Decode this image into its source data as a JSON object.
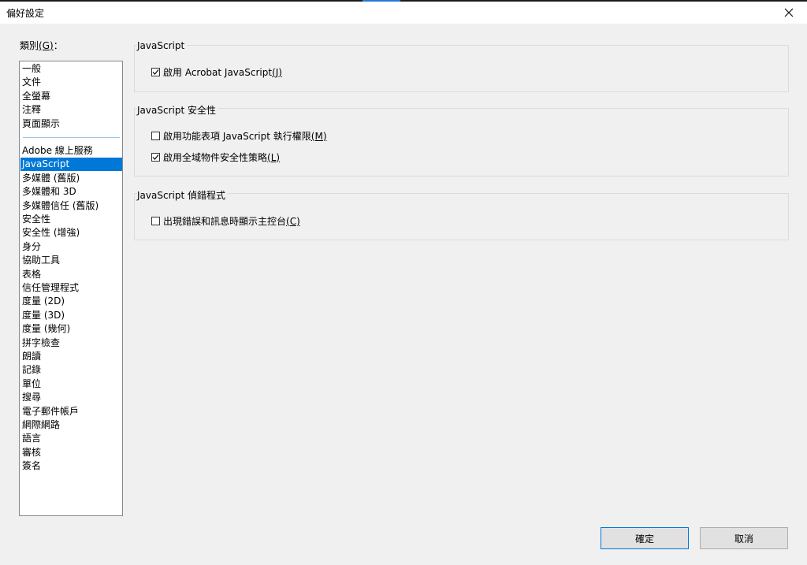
{
  "window": {
    "title": "偏好設定"
  },
  "sidebar": {
    "label": "類別",
    "accel": "(G)",
    "suffix": "：",
    "top_items": [
      "一般",
      "文件",
      "全螢幕",
      "注釋",
      "頁面顯示"
    ],
    "items": [
      "Adobe 線上服務",
      "JavaScript",
      "多媒體 (舊版)",
      "多媒體和 3D",
      "多媒體信任 (舊版)",
      "安全性",
      "安全性 (增強)",
      "身分",
      "協助工具",
      "表格",
      "信任管理程式",
      "度量 (2D)",
      "度量 (3D)",
      "度量 (幾何)",
      "拼字檢查",
      "朗讀",
      "記錄",
      "單位",
      "搜尋",
      "電子郵件帳戶",
      "網際網路",
      "語言",
      "審核",
      "簽名"
    ],
    "selected": "JavaScript"
  },
  "groups": {
    "js": {
      "title": "JavaScript",
      "enable_label": "啟用 Acrobat JavaScript",
      "enable_accel": "(J)",
      "enable_checked": true
    },
    "security": {
      "title": "JavaScript 安全性",
      "menu_label": "啟用功能表項 JavaScript 執行權限",
      "menu_accel": "(M)",
      "menu_checked": false,
      "global_label": "啟用全域物件安全性策略",
      "global_accel": "(L)",
      "global_checked": true
    },
    "debugger": {
      "title": "JavaScript 偵錯程式",
      "console_label": "出現錯誤和訊息時顯示主控台",
      "console_accel": "(C)",
      "console_checked": false
    }
  },
  "buttons": {
    "ok": "確定",
    "cancel": "取消"
  },
  "colors": {
    "selection": "#0078d7",
    "background": "#f0f0f0"
  }
}
